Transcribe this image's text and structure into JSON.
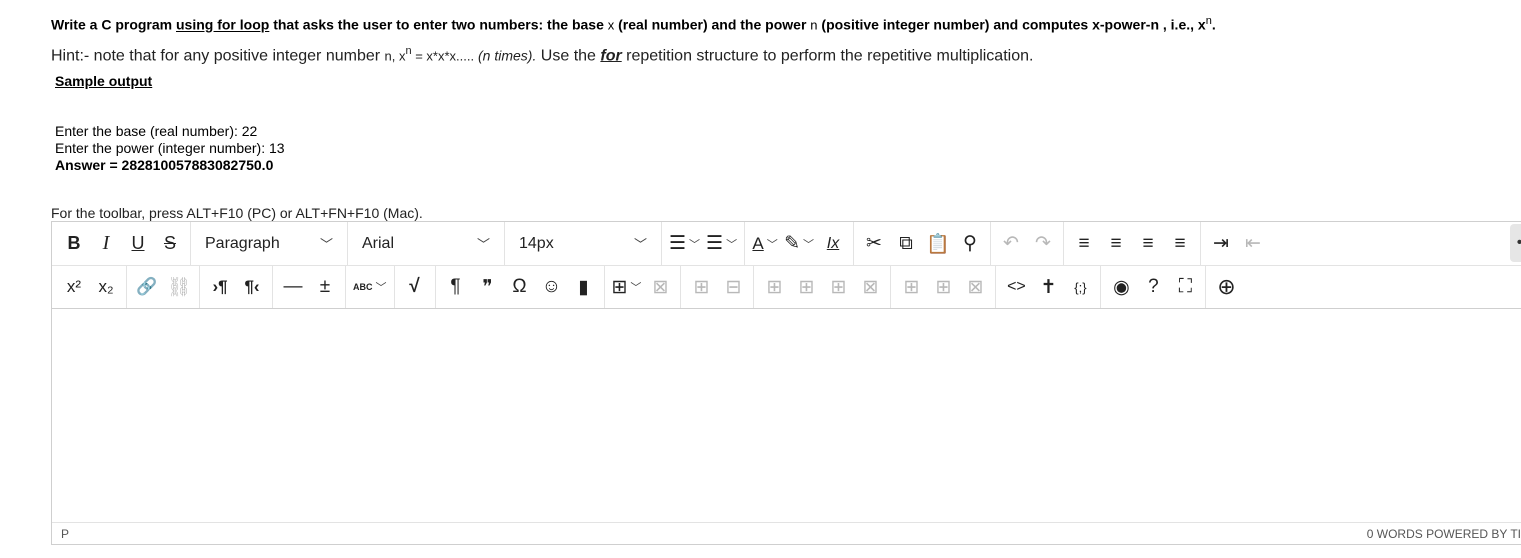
{
  "question": {
    "part1": "Write a C program ",
    "link": "using for loop",
    "part2": " that asks the user to enter two numbers: the base ",
    "var_x": "x",
    "part3": " (real number) and the power ",
    "var_n": "n",
    "part4": " (positive integer number) and computes x-power-n , i.e., x",
    "sup": "n",
    "part5": "."
  },
  "hint": {
    "part1": "Hint:- note that for any positive integer number ",
    "var_n": "n, x",
    "sup": "n",
    "expr": " = x*x*x.....",
    "times": " (n times).",
    "part2": " Use the ",
    "for_word": "for",
    "part3": " repetition structure to perform the repetitive multiplication."
  },
  "sample": {
    "title": "Sample output",
    "line1": "Enter the base (real number): 22",
    "line2": "Enter the power (integer number): 13",
    "line3": "Answer  = 282810057883082750.0"
  },
  "toolbar_note": "For the toolbar, press ALT+F10 (PC) or ALT+FN+F10 (Mac).",
  "toolbar": {
    "bold": "B",
    "italic": "I",
    "underline": "U",
    "strike": "S",
    "block_format": "Paragraph",
    "font_family": "Arial",
    "font_size": "14px",
    "bullet": "☰",
    "numbered": "☰",
    "text_color": "A",
    "highlight": "✎",
    "clear_format": "Ix",
    "cut": "✂",
    "copy": "⧉",
    "paste": "📋",
    "find": "⚲",
    "undo": "↶",
    "redo": "↷",
    "align_left": "≡",
    "align_center": "≡",
    "align_right": "≡",
    "justify": "≡",
    "indent": "⇥",
    "outdent": "⇤",
    "more": "••",
    "superscript": "x²",
    "subscript": "x₂",
    "link": "🔗",
    "unlink": "⛓",
    "ltr": "›¶",
    "rtl": "¶‹",
    "hr": "—",
    "insert": "±",
    "spell": "ABC",
    "math": "√",
    "pilcrow": "¶",
    "quote": "❞",
    "omega": "Ω",
    "emoji": "☺",
    "bookmark": "▮",
    "table": "⊞",
    "tbl_del": "⊠",
    "row_before": "⊞",
    "row_after": "⊟",
    "col_before": "⊞",
    "cell_split": "⊞",
    "cell_merge": "⊞",
    "cell_del": "⊠",
    "col_a": "⊞",
    "col_b": "⊞",
    "col_del": "⊠",
    "code": "<>",
    "a11y": "✝",
    "template": "{;}",
    "preview": "◉",
    "help": "?",
    "fullscreen": "⛶",
    "add": "⊕"
  },
  "status": {
    "path": "P",
    "word_count": "0 WORDS  POWERED BY TI"
  }
}
